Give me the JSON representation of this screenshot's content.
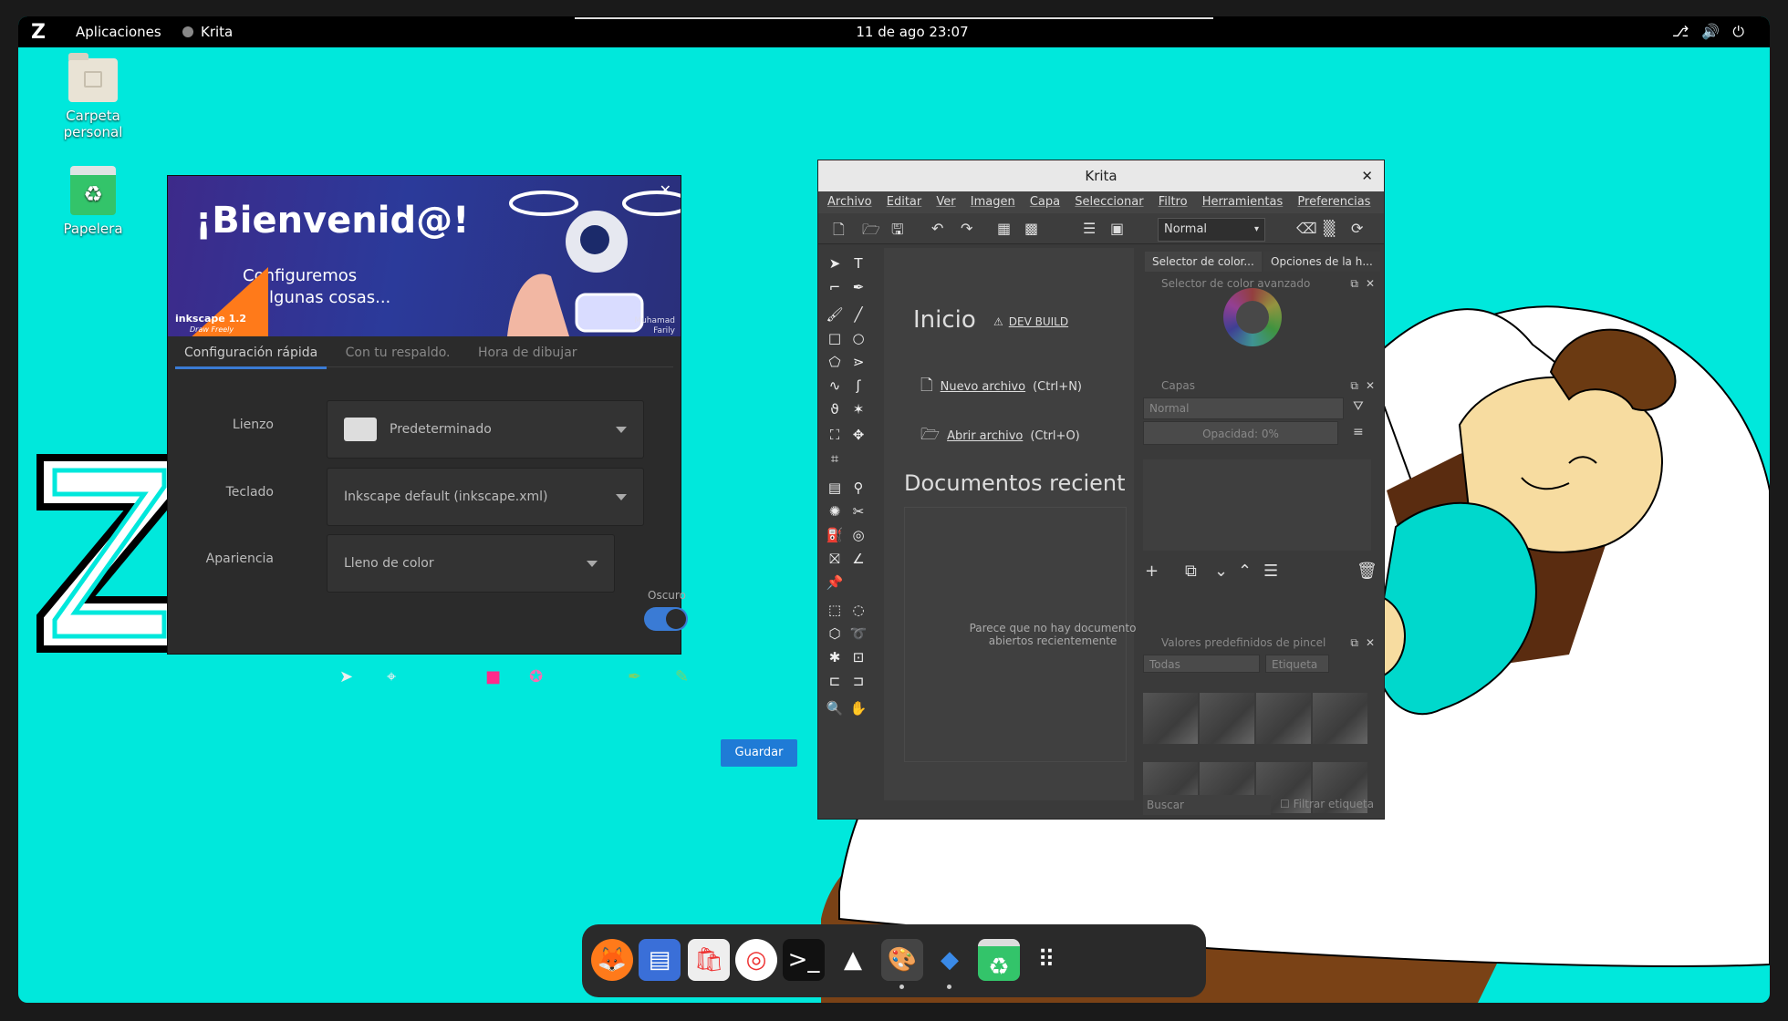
{
  "topbar": {
    "logo": "Z",
    "applications": "Aplicaciones",
    "active_app": "Krita",
    "clock": "11 de ago  23:07",
    "tray_icons": [
      "network-icon",
      "volume-icon",
      "power-icon"
    ]
  },
  "desktop": {
    "icons": [
      {
        "label": "Carpeta personal",
        "icon": "home-folder-icon"
      },
      {
        "label": "Papelera",
        "icon": "trash-icon"
      }
    ],
    "background_color": "#00e8dc"
  },
  "inkscape": {
    "banner_title": "¡Bienvenid@!",
    "banner_subtitle_1": "Configuremos",
    "banner_subtitle_2": "algunas cosas...",
    "badge": "inkscape 1.2",
    "badge_sub": "Draw Freely",
    "author_1": "Muhamad",
    "author_2": "Farily",
    "tabs": [
      "Configuración rápida",
      "Con tu respaldo.",
      "Hora de dibujar"
    ],
    "active_tab": 0,
    "rows": {
      "canvas_label": "Lienzo",
      "canvas_value": "Predeterminado",
      "keyboard_label": "Teclado",
      "keyboard_value": "Inkscape default (inkscape.xml)",
      "appearance_label": "Apariencia",
      "appearance_value": "Lleno de color",
      "dark_label": "Oscuro",
      "dark_on": true
    },
    "save_button": "Guardar"
  },
  "krita": {
    "title": "Krita",
    "menu": [
      "Archivo",
      "Editar",
      "Ver",
      "Imagen",
      "Capa",
      "Seleccionar",
      "Filtro",
      "Herramientas",
      "Preferencias"
    ],
    "blend_mode": "Normal",
    "welcome": {
      "heading": "Inicio",
      "dev_build": "DEV BUILD",
      "new_file": "Nuevo archivo",
      "new_file_shortcut": "(Ctrl+N)",
      "open_file": "Abrir archivo",
      "open_file_shortcut": "(Ctrl+O)",
      "recent_heading": "Documentos recient",
      "recent_empty_1": "Parece que no hay documento",
      "recent_empty_2": "abiertos recientemente"
    },
    "dock_tabs": [
      "Selector de color...",
      "Opciones de la h..."
    ],
    "color_selector_title": "Selector de color avanzado",
    "layers_title": "Capas",
    "layers_blend": "Normal",
    "opacity_label": "Opacidad:  0%",
    "brush_presets_title": "Valores predefinidos de pincel",
    "brush_filter": "Todas",
    "brush_tag": "Etiqueta",
    "search_placeholder": "Buscar",
    "filter_tag_label": "Filtrar etiqueta"
  },
  "dock": {
    "apps": [
      "firefox-icon",
      "text-editor-icon",
      "software-store-icon",
      "help-icon",
      "terminal-icon",
      "inkscape-icon",
      "krita-icon",
      "gparted-icon",
      "trash-icon",
      "app-grid-icon"
    ]
  }
}
